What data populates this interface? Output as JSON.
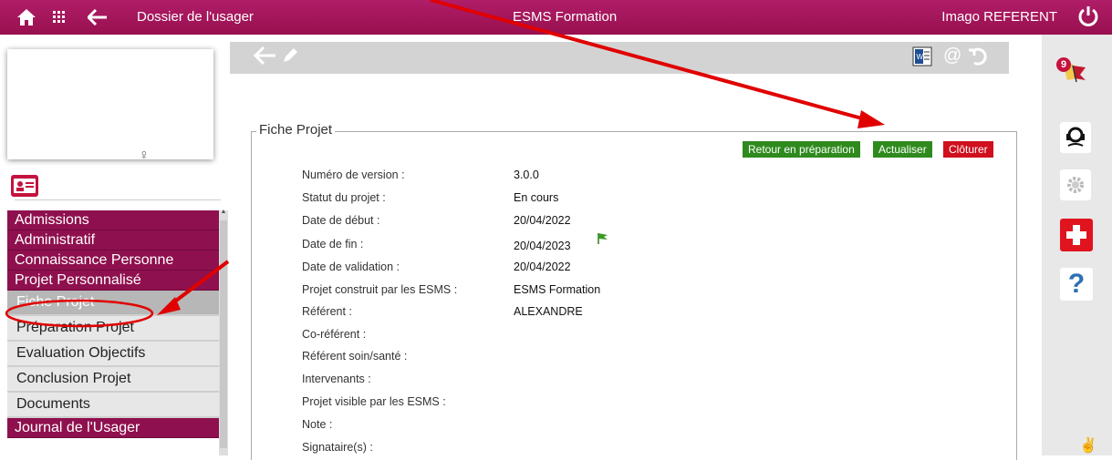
{
  "topbar": {
    "title_left": "Dossier de l'usager",
    "title_center": "ESMS Formation",
    "user": "Imago REFERENT",
    "icons": [
      "home-icon",
      "grid-icon",
      "back-arrow-icon",
      "power-icon"
    ]
  },
  "sidebar": {
    "menu_top": [
      {
        "label": "Admissions"
      },
      {
        "label": "Administratif"
      },
      {
        "label": "Connaissance Personne"
      },
      {
        "label": "Projet Personnalisé"
      }
    ],
    "submenu": [
      {
        "label": "Fiche Projet",
        "active": true
      },
      {
        "label": "Préparation Projet",
        "active": false
      },
      {
        "label": "Evaluation Objectifs",
        "active": false
      },
      {
        "label": "Conclusion Projet",
        "active": false
      },
      {
        "label": "Documents",
        "active": false
      }
    ],
    "menu_bottom": [
      {
        "label": "Journal de l'Usager"
      }
    ]
  },
  "main": {
    "section_title": "Fiche Projet",
    "buttons": {
      "retour": "Retour en préparation",
      "actualiser": "Actualiser",
      "cloturer": "Clôturer"
    },
    "fields": [
      {
        "label": "Numéro de version :",
        "value": "3.0.0"
      },
      {
        "label": "Statut du projet :",
        "value": "En cours"
      },
      {
        "label": "Date de début :",
        "value": "20/04/2022"
      },
      {
        "label": "Date de fin :",
        "value": "20/04/2023"
      },
      {
        "label": "Date de validation :",
        "value": "20/04/2022"
      },
      {
        "label": "Projet construit par les ESMS :",
        "value": "ESMS Formation"
      },
      {
        "label": "Référent :",
        "value": "ALEXANDRE"
      },
      {
        "label": "Co-référent :",
        "value": ""
      },
      {
        "label": "Référent soin/santé :",
        "value": ""
      },
      {
        "label": "Intervenants :",
        "value": ""
      },
      {
        "label": "Projet visible par les ESMS :",
        "value": ""
      },
      {
        "label": "Note :",
        "value": ""
      },
      {
        "label": "Signataire(s) :",
        "value": ""
      }
    ]
  },
  "rail": {
    "notification_count": "9"
  },
  "colors": {
    "brand": "#a8165f",
    "menu": "#8f104e",
    "green_button": "#2f8a1e",
    "red_button": "#d00f1f",
    "annotation": "#e00000"
  }
}
